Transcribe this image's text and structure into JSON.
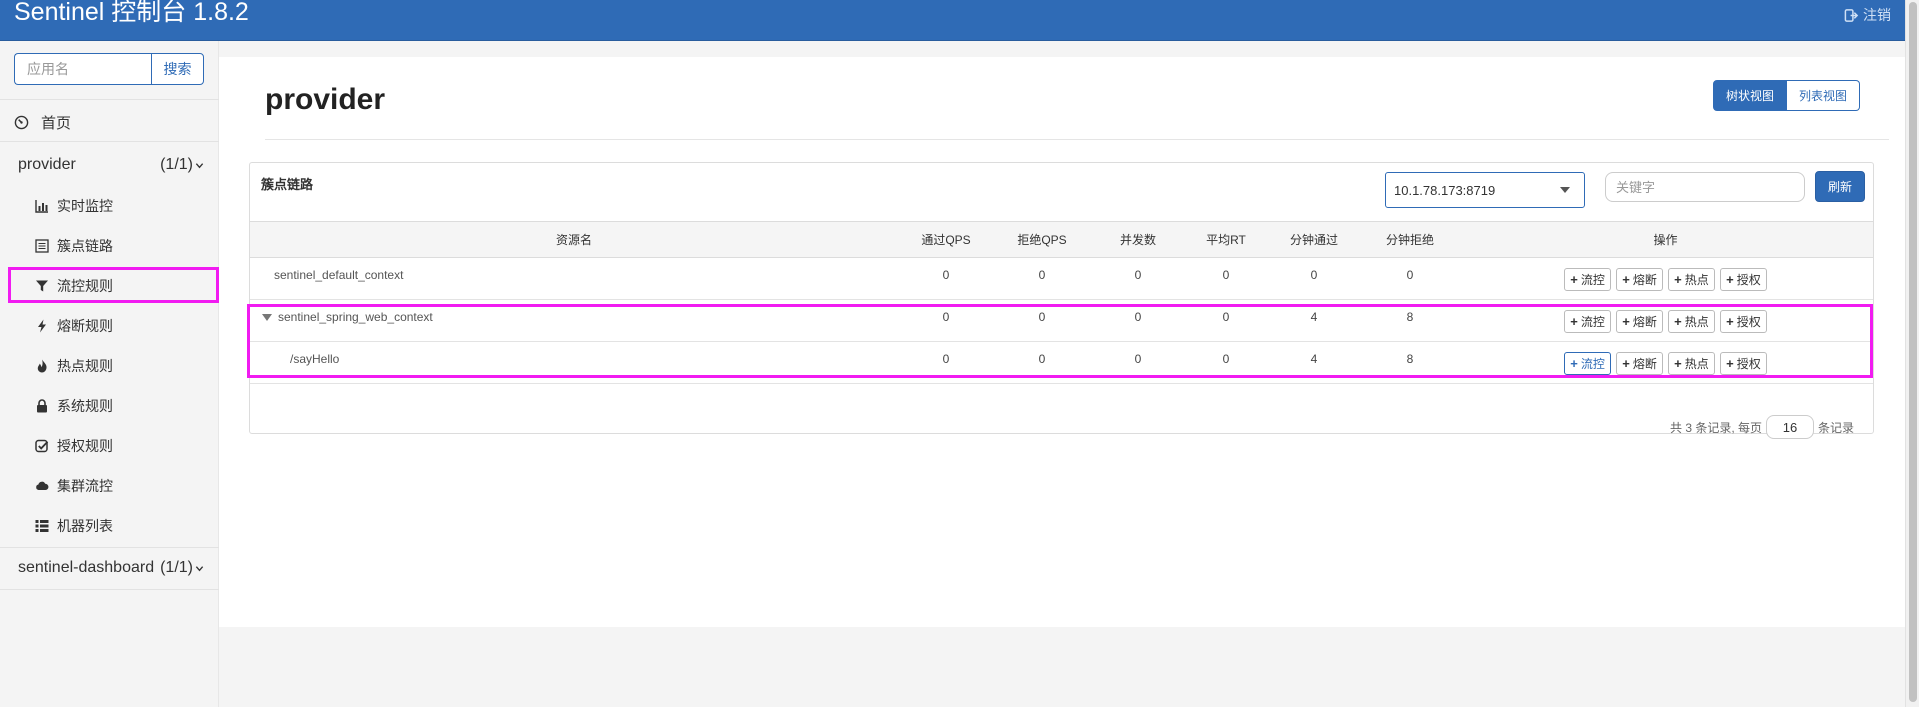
{
  "app": {
    "title": "Sentinel 控制台 1.8.2",
    "logout_label": "注销"
  },
  "sidebar": {
    "search_placeholder": "应用名",
    "search_button": "搜索",
    "home_label": "首页",
    "apps": [
      {
        "name": "provider",
        "count": "(1/1)"
      },
      {
        "name": "sentinel-dashboard",
        "count": "(1/1)"
      }
    ],
    "menu": [
      {
        "label": "实时监控",
        "icon": "bar-chart-icon"
      },
      {
        "label": "簇点链路",
        "icon": "list-alt-icon",
        "selected": true
      },
      {
        "label": "流控规则",
        "icon": "filter-icon"
      },
      {
        "label": "熔断规则",
        "icon": "flash-icon"
      },
      {
        "label": "热点规则",
        "icon": "fire-icon"
      },
      {
        "label": "系统规则",
        "icon": "lock-icon"
      },
      {
        "label": "授权规则",
        "icon": "check-circle-icon"
      },
      {
        "label": "集群流控",
        "icon": "cloud-icon"
      },
      {
        "label": "机器列表",
        "icon": "th-list-icon"
      }
    ]
  },
  "main": {
    "title": "provider",
    "view_tree": "树状视图",
    "view_list": "列表视图",
    "panel_title": "簇点链路",
    "machine": "10.1.78.173:8719",
    "keyword_placeholder": "关键字",
    "refresh": "刷新",
    "columns": [
      "资源名",
      "通过QPS",
      "拒绝QPS",
      "并发数",
      "平均RT",
      "分钟通过",
      "分钟拒绝",
      "操作"
    ],
    "rows": [
      {
        "name": "sentinel_default_context",
        "pass": "0",
        "block": "0",
        "thread": "0",
        "rt": "0",
        "min_pass": "0",
        "min_block": "0"
      },
      {
        "name": "sentinel_spring_web_context",
        "pass": "0",
        "block": "0",
        "thread": "0",
        "rt": "0",
        "min_pass": "4",
        "min_block": "8"
      },
      {
        "name": "/sayHello",
        "pass": "0",
        "block": "0",
        "thread": "0",
        "rt": "0",
        "min_pass": "4",
        "min_block": "8"
      }
    ],
    "ops": [
      "流控",
      "熔断",
      "热点",
      "授权"
    ],
    "pager": {
      "prefix": "共 3 条记录, 每页",
      "page_size": "16",
      "suffix": "条记录"
    }
  },
  "colors": {
    "accent": "#2f6bb6",
    "highlight": "#f11bf1"
  }
}
